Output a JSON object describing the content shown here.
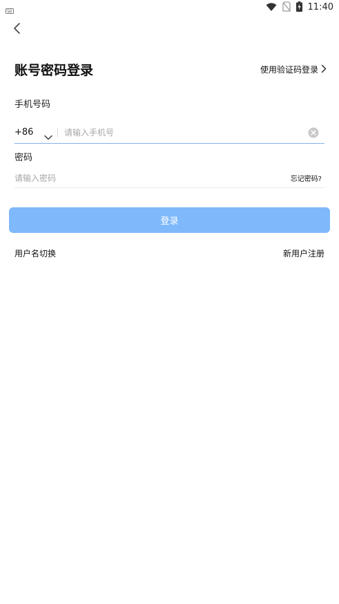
{
  "status_bar": {
    "time": "11:40",
    "icons": [
      "keyboard-icon",
      "wifi-icon",
      "no-sim-icon",
      "battery-charging-icon"
    ]
  },
  "header": {
    "back_icon": "chevron-left-icon",
    "title": "账号密码登录",
    "alt_login_label": "使用验证码登录",
    "alt_login_icon": "chevron-right-icon"
  },
  "phone": {
    "label": "手机号码",
    "country_code": "+86",
    "country_icon": "chevron-down-icon",
    "placeholder": "请输入手机号",
    "value": "",
    "clear_icon": "clear-circle-icon"
  },
  "password": {
    "label": "密码",
    "placeholder": "请输入密码",
    "value": "",
    "forgot_label": "忘记密码?"
  },
  "login_button": {
    "label": "登录",
    "color": "#7fb9fb"
  },
  "footer": {
    "switch_username_label": "用户名切换",
    "register_label": "新用户注册"
  },
  "colors": {
    "accent": "#7fb9fb",
    "focus_underline": "#7eb5ea",
    "placeholder": "#a7a7a7"
  }
}
